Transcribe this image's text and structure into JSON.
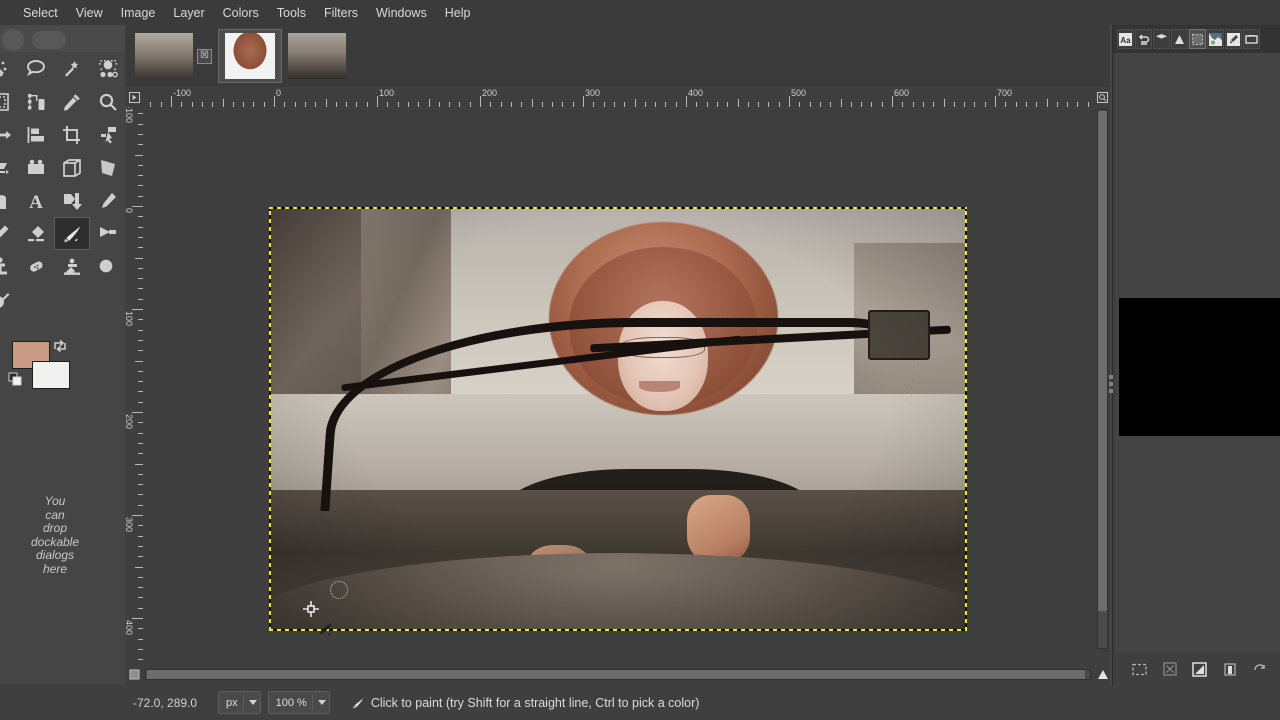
{
  "app": {
    "name": "GIMP"
  },
  "menubar": {
    "items": [
      {
        "label": "Select",
        "name": "menu-select"
      },
      {
        "label": "View",
        "name": "menu-view"
      },
      {
        "label": "Image",
        "name": "menu-image"
      },
      {
        "label": "Layer",
        "name": "menu-layer"
      },
      {
        "label": "Colors",
        "name": "menu-colors"
      },
      {
        "label": "Tools",
        "name": "menu-tools"
      },
      {
        "label": "Filters",
        "name": "menu-filters"
      },
      {
        "label": "Windows",
        "name": "menu-windows"
      },
      {
        "label": "Help",
        "name": "menu-help"
      }
    ]
  },
  "toolbox": {
    "tools": [
      "fuzzy-select-tool",
      "free-select-tool",
      "magic-wand-tool",
      "select-by-color-tool",
      "paths-tool",
      "measure-tool",
      "color-picker-tool",
      "zoom-tool",
      "move-tool",
      "align-tool",
      "crop-tool",
      "transform-tool",
      "shear-tool",
      "perspective-tool",
      "warp-tool",
      "3d-transform-tool",
      "cage-transform-tool",
      "bucket-fill-tool",
      "text-tool",
      "gradient-tool",
      "pencil-tool",
      "paintbrush-tool",
      "eraser-tool",
      "ink-tool",
      "airbrush-tool",
      "clone-tool",
      "heal-tool",
      "smudge-tool",
      "dodge-burn-tool",
      "mypaint-brush-tool"
    ],
    "selected_tool": "ink-tool",
    "foreground_color": "#c99a84",
    "background_color": "#f0f2ef",
    "dock_hint": "You can drop dockable dialogs here",
    "dock_hint_lines": [
      "You",
      "can",
      "drop",
      "dockable",
      "dialogs",
      "here"
    ]
  },
  "tabstrip": {
    "tabs": [
      {
        "name": "image-tab-1",
        "active": false,
        "close_label": "☒"
      },
      {
        "name": "image-tab-2",
        "active": true
      },
      {
        "name": "image-tab-3",
        "active": false
      }
    ]
  },
  "rulers": {
    "unit": "px",
    "horizontal_labels": [
      "-100",
      "0",
      "100",
      "200",
      "300",
      "400",
      "500",
      "600",
      "700"
    ],
    "vertical_labels": [
      "-100",
      "0",
      "100",
      "200",
      "300",
      "400"
    ]
  },
  "canvas": {
    "selection_border": "marching-ants",
    "image_description": "person with large afro wig driving a convertible on a desert road",
    "cursor_tool": "ink-tool"
  },
  "right_dock": {
    "tabs": [
      {
        "name": "tab-fonts-icon",
        "glyph": "Aa",
        "active": false
      },
      {
        "name": "tab-undo-history-icon",
        "glyph": "↩",
        "active": false
      },
      {
        "name": "tab-layers-icon",
        "glyph": "☰",
        "active": false
      },
      {
        "name": "tab-channels-icon",
        "glyph": "▲",
        "active": false
      },
      {
        "name": "tab-gradients-icon",
        "glyph": "▢",
        "active": true
      },
      {
        "name": "tab-patterns-icon",
        "glyph": "◩",
        "active": false
      },
      {
        "name": "tab-brushes-icon",
        "glyph": "✎",
        "active": false
      },
      {
        "name": "tab-images-icon",
        "glyph": "⬜",
        "active": false
      }
    ],
    "bottom_buttons": [
      {
        "name": "new-item-button",
        "glyph": "⬚"
      },
      {
        "name": "raise-item-button",
        "glyph": "☒"
      },
      {
        "name": "duplicate-item-button",
        "glyph": "◧"
      },
      {
        "name": "delete-item-button",
        "glyph": "Ὕ1"
      },
      {
        "name": "refresh-button",
        "glyph": "↺"
      }
    ]
  },
  "statusbar": {
    "position": "-72.0, 289.0",
    "unit_value": "px",
    "zoom_value": "100 %",
    "message": "Click to paint (try Shift for a straight line, Ctrl to pick a color)",
    "message_icon": "ink-tool-icon"
  }
}
